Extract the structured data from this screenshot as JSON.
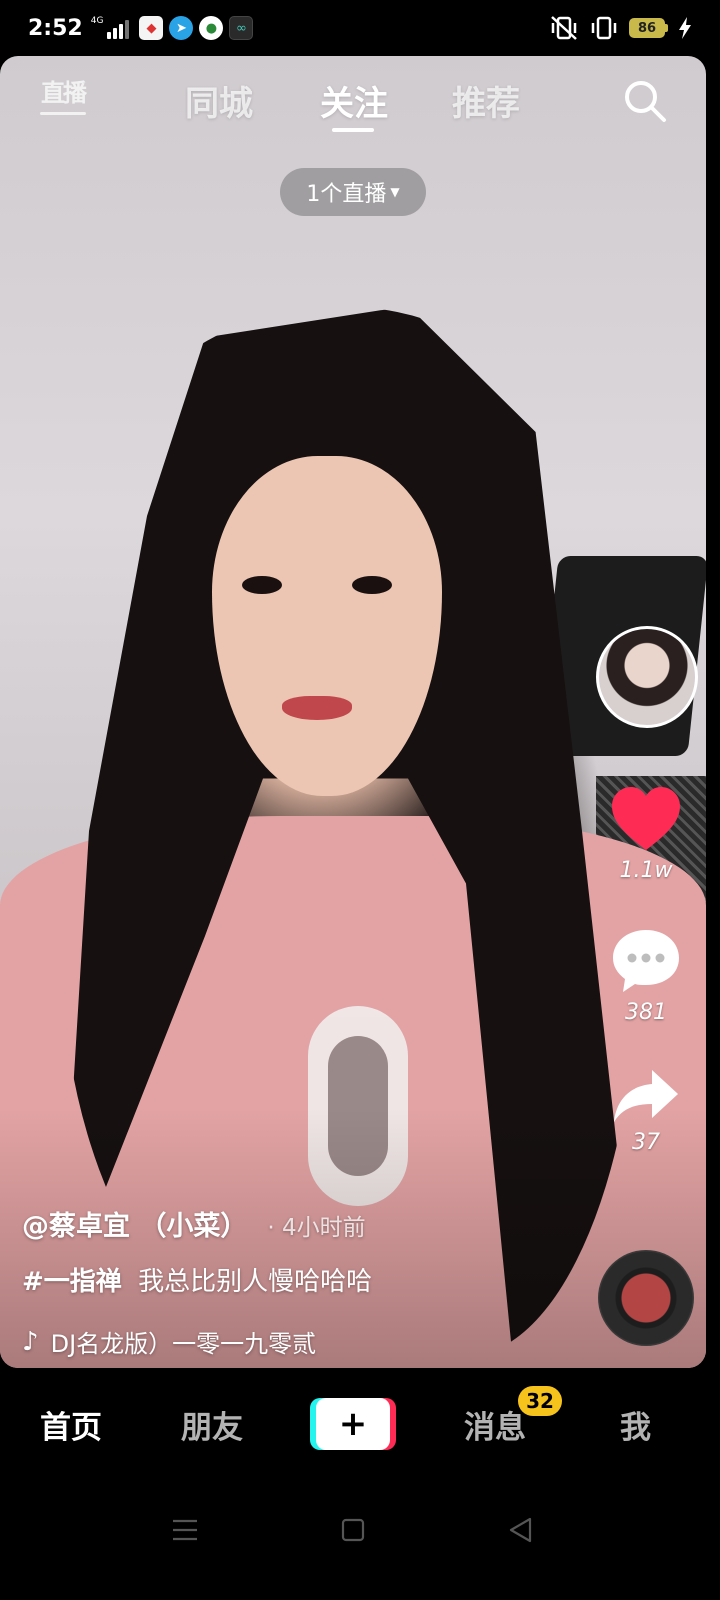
{
  "status_bar": {
    "time": "2:52",
    "network": "4G",
    "battery": "86",
    "notification_icons": [
      "app-icon-a",
      "telegram-icon",
      "app-icon-green",
      "app-icon-teal"
    ]
  },
  "top_nav": {
    "live_icon_label": "直播",
    "tabs": [
      "同城",
      "关注",
      "推荐"
    ],
    "active_tab": "关注",
    "search_icon": "search-icon"
  },
  "live_pill": {
    "label": "1个直播"
  },
  "video": {
    "author": "@蔡卓宜 （小菜）",
    "time_ago": "· 4小时前",
    "hashtag": "#一指禅",
    "description": "我总比别人慢哈哈哈",
    "music": "DJ名龙版）一零一九零贰"
  },
  "actions": {
    "likes": "1.1w",
    "comments": "381",
    "shares": "37"
  },
  "bottom_nav": {
    "items": [
      "首页",
      "朋友",
      "消息",
      "我"
    ],
    "active": "首页",
    "messages_badge": "32"
  },
  "colors": {
    "like": "#fe2c55",
    "badge": "#f6c21c",
    "plus_cyan": "#25f4ee",
    "plus_red": "#fe2c55"
  }
}
